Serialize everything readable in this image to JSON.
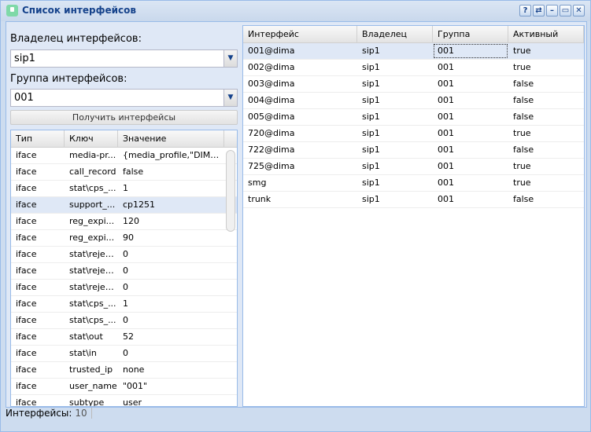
{
  "window": {
    "title": "Список интерфейсов",
    "tools": [
      "?",
      "⇄",
      "–",
      "▭",
      "✕"
    ]
  },
  "form": {
    "owner_label": "Владелец интерфейсов:",
    "owner_value": "sip1",
    "group_label": "Группа интерфейсов:",
    "group_value": "001",
    "get_button": "Получить интерфейсы"
  },
  "props": {
    "columns": [
      "Тип",
      "Ключ",
      "Значение"
    ],
    "rows": [
      [
        "iface",
        "media-pr...",
        "{media_profile,\"DIMA\",\"..."
      ],
      [
        "iface",
        "call_record",
        "false"
      ],
      [
        "iface",
        "stat\\cps_...",
        "1"
      ],
      [
        "iface",
        "support_...",
        "cp1251"
      ],
      [
        "iface",
        "reg_expi...",
        "120"
      ],
      [
        "iface",
        "reg_expi...",
        "90"
      ],
      [
        "iface",
        "stat\\rejec...",
        "0"
      ],
      [
        "iface",
        "stat\\rejec...",
        "0"
      ],
      [
        "iface",
        "stat\\rejec...",
        "0"
      ],
      [
        "iface",
        "stat\\cps_...",
        "1"
      ],
      [
        "iface",
        "stat\\cps_...",
        "0"
      ],
      [
        "iface",
        "stat\\out",
        "52"
      ],
      [
        "iface",
        "stat\\in",
        "0"
      ],
      [
        "iface",
        "trusted_ip",
        "none"
      ],
      [
        "iface",
        "user_name",
        "\"001\""
      ],
      [
        "iface",
        "subtype",
        "user"
      ]
    ],
    "selected_row": 3
  },
  "interfaces": {
    "columns": [
      "Интерфейс",
      "Владелец",
      "Группа",
      "Активный"
    ],
    "rows": [
      [
        "001@dima",
        "sip1",
        "001",
        "true"
      ],
      [
        "002@dima",
        "sip1",
        "001",
        "true"
      ],
      [
        "003@dima",
        "sip1",
        "001",
        "false"
      ],
      [
        "004@dima",
        "sip1",
        "001",
        "false"
      ],
      [
        "005@dima",
        "sip1",
        "001",
        "false"
      ],
      [
        "720@dima",
        "sip1",
        "001",
        "true"
      ],
      [
        "722@dima",
        "sip1",
        "001",
        "false"
      ],
      [
        "725@dima",
        "sip1",
        "001",
        "true"
      ],
      [
        "smg",
        "sip1",
        "001",
        "true"
      ],
      [
        "trunk",
        "sip1",
        "001",
        "false"
      ]
    ],
    "selected_row": 0
  },
  "status": {
    "label": "Интерфейсы:",
    "count": "10"
  }
}
